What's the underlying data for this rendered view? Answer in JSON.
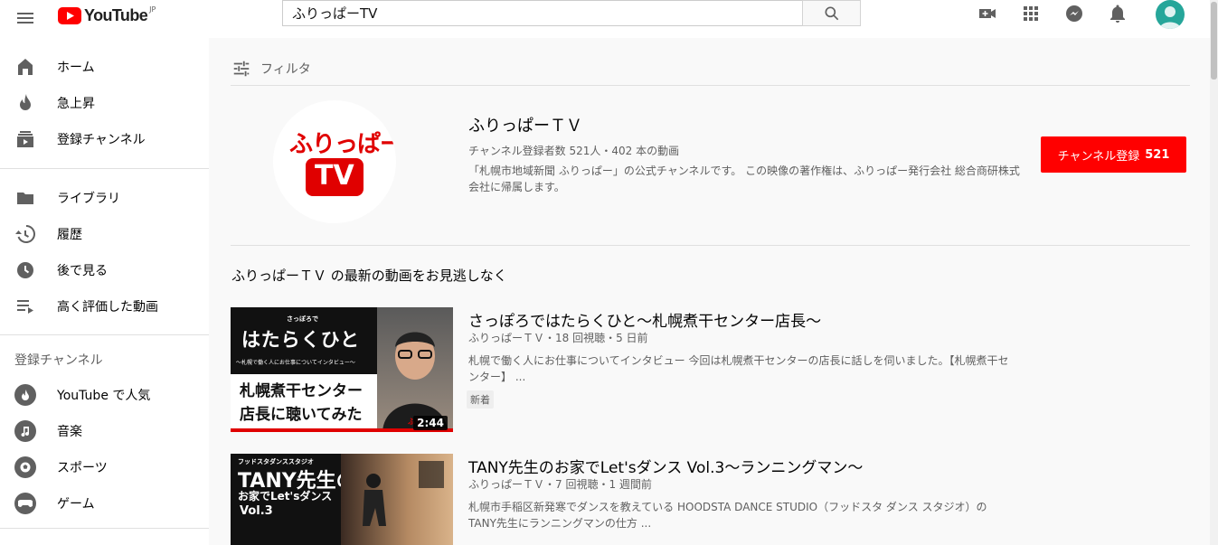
{
  "header": {
    "logo_text": "YouTube",
    "logo_region": "JP",
    "search_value": "ふりっぱーTV",
    "brand_color": "#ff0000"
  },
  "sidebar": {
    "primary": [
      {
        "label": "ホーム",
        "icon": "home-icon"
      },
      {
        "label": "急上昇",
        "icon": "trending-icon"
      },
      {
        "label": "登録チャンネル",
        "icon": "subscriptions-icon"
      }
    ],
    "secondary": [
      {
        "label": "ライブラリ",
        "icon": "library-icon"
      },
      {
        "label": "履歴",
        "icon": "history-icon"
      },
      {
        "label": "後で見る",
        "icon": "watch-later-icon"
      },
      {
        "label": "高く評価した動画",
        "icon": "liked-videos-icon"
      }
    ],
    "subs_title": "登録チャンネル",
    "subs": [
      {
        "label": "YouTube で人気",
        "icon": "popular-icon"
      },
      {
        "label": "音楽",
        "icon": "music-icon"
      },
      {
        "label": "スポーツ",
        "icon": "sports-icon"
      },
      {
        "label": "ゲーム",
        "icon": "gaming-icon"
      }
    ]
  },
  "main": {
    "filter_label": "フィルタ",
    "channel": {
      "name": "ふりっぱーＴＶ",
      "meta": "チャンネル登録者数 521人・402 本の動画",
      "description": "「札幌市地域新聞 ふりっぱー」の公式チャンネルです。 この映像の著作権は、ふりっぱー発行会社 総合商研株式会社に帰属します。",
      "subscribe_label": "チャンネル登録",
      "subscribe_count": "521",
      "logo_line1": "ふりっぱー",
      "logo_line2": "TV"
    },
    "latest_title": "ふりっぱーＴＶ の最新の動画をお見逃しなく",
    "videos": [
      {
        "title": "さっぽろではたらくひと～札幌煮干センター店長～",
        "meta": "ふりっぱーＴＶ・18 回視聴・5 日前",
        "description": "札幌で働く人にお仕事についてインタビュー 今回は札幌煮干センターの店長に話しを伺いました。【札幌煮干センター】 ...",
        "badge": "新着",
        "duration": "2:44",
        "thumb_small": "さっぽろで",
        "thumb_big": "はたらくひと",
        "thumb_sub": "～札幌で働く人にお仕事についてインタビュー～",
        "thumb_line1": "札幌煮干センター",
        "thumb_line2": "店長に聴いてみた",
        "thumb_corner": "ふり"
      },
      {
        "title": "TANY先生のお家でLet'sダンス Vol.3～ランニングマン～",
        "meta": "ふりっぱーＴＶ・7 回視聴・1 週間前",
        "description": "札幌市手稲区新発寒でダンスを教えている HOODSTA DANCE STUDIO（フッドスタ ダンス スタジオ）の TANY先生にランニングマンの仕方 ...",
        "thumb_small": "フッドスタダンススタジオ",
        "thumb_big": "TANY先生の",
        "thumb_line1": "お家でLet'sダンス",
        "thumb_line2": "Vol.3"
      }
    ]
  }
}
